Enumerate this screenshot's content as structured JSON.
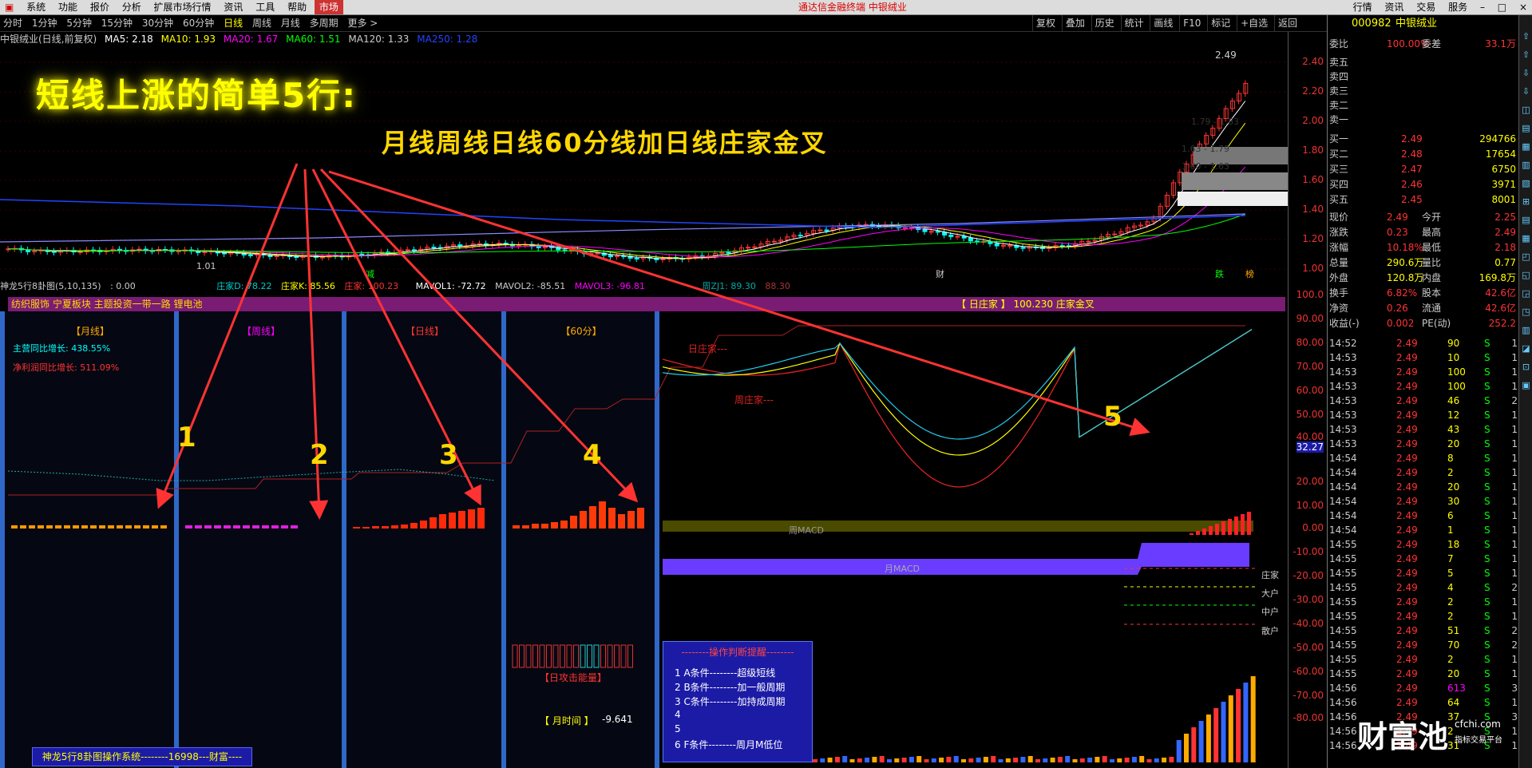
{
  "menu": {
    "items": [
      "系统",
      "功能",
      "报价",
      "分析",
      "扩展市场行情",
      "资讯",
      "工具",
      "帮助"
    ],
    "market": "市场",
    "center_title": "通达信金融终端  中银绒业",
    "right_items": [
      "行情",
      "资讯",
      "交易",
      "服务"
    ]
  },
  "toolbar": {
    "periods": [
      "分时",
      "1分钟",
      "5分钟",
      "15分钟",
      "30分钟",
      "60分钟",
      "日线",
      "周线",
      "月线",
      "多周期",
      "更多 >"
    ],
    "active": "日线",
    "right_items": [
      "复权",
      "叠加",
      "历史",
      "统计",
      "画线",
      "F10",
      "标记",
      "+自选",
      "返回"
    ]
  },
  "info": {
    "title": "中银绒业(日线,前复权)",
    "ma5": "MA5: 2.18",
    "ma10": "MA10: 1.93",
    "ma20": "MA20: 1.67",
    "ma60": "MA60: 1.51",
    "ma120": "MA120: 1.33",
    "ma250": "MA250: 1.28",
    "high_label": "2.49",
    "low_label": "1.01",
    "box1": "1.79 - 1.83",
    "box2": "1.63 - 1.79",
    "box3": "1.60 - 1.63",
    "marks": [
      "减",
      "财",
      "跌",
      "榜"
    ]
  },
  "headline": "短线上涨的简单5行:",
  "subline": "月线周线日线60分线加日线庄家金叉",
  "arrow_numbers": [
    "1",
    "2",
    "3",
    "4",
    "5"
  ],
  "subheader": {
    "name": "神龙5行8卦图(5,10,135)",
    "v0": ": 0.00",
    "d": "庄家D: 78.22",
    "k": "庄家K: 85.56",
    "z": "庄家: 100.23",
    "mavol1": "MAVOL1: -72.72",
    "mavol2": "MAVOL2: -85.51",
    "mavol3": "MAVOL3: -96.81",
    "zj": "周ZJ1: 89.30",
    "zj2": "88.30"
  },
  "purplebar": {
    "left": "纺织服饰 宁夏板块 主题投资一带一路 锂电池",
    "right": "【 日庄家 】 100.230  庄家金叉"
  },
  "panels": {
    "monthly": "【月线】",
    "weekly": "【周线】",
    "daily": "【日线】",
    "h60": "【60分】",
    "growth1": "主营同比增长: 438.55%",
    "growth2": "净利润同比增长: 511.09%",
    "day_zhuang": "日庄家---",
    "week_zhuang": "周庄家---",
    "week_macd": "周MACD",
    "month_macd": "月MACD",
    "legend": [
      "庄家",
      "大户",
      "中户",
      "散户"
    ],
    "attack": "【日攻击能量】",
    "month_time_label": "【 月时间 】",
    "month_time_value": "-9.641"
  },
  "opbox": {
    "title": "--------操作判断提醒--------",
    "lines": [
      "1  A条件--------超级短线",
      "2  B条件--------加一般周期",
      "3  C条件--------加持成周期",
      "4",
      "5",
      "6  F条件--------周月M低位"
    ]
  },
  "sysbar": "神龙5行8卦图操作系统--------16998---财富----",
  "yaxis_main": [
    "2.40",
    "2.20",
    "2.00",
    "1.80",
    "1.60",
    "1.40",
    "1.20",
    "1.00"
  ],
  "yaxis_ind": [
    "100.0",
    "90.00",
    "80.00",
    "70.00",
    "60.00",
    "50.00",
    "40.00",
    "32.27",
    "20.00",
    "10.00",
    "0.00",
    "-10.00",
    "-20.00",
    "-30.00",
    "-40.00",
    "-50.00",
    "-60.00",
    "-70.00",
    "-80.00"
  ],
  "quote": {
    "code": "000982",
    "name": "中银绒业",
    "weibi_label": "委比",
    "weibi": "100.00%",
    "weicha_label": "委差",
    "weicha": "33.1万",
    "sells": [
      "卖五",
      "卖四",
      "卖三",
      "卖二",
      "卖一"
    ],
    "buys": [
      [
        "买一",
        "2.49",
        "294766"
      ],
      [
        "买二",
        "2.48",
        "17654"
      ],
      [
        "买三",
        "2.47",
        "6750"
      ],
      [
        "买四",
        "2.46",
        "3971"
      ],
      [
        "买五",
        "2.45",
        "8001"
      ]
    ],
    "stats": [
      [
        "现价",
        "2.49",
        "今开",
        "2.25"
      ],
      [
        "涨跌",
        "0.23",
        "最高",
        "2.49"
      ],
      [
        "涨幅",
        "10.18%",
        "最低",
        "2.18"
      ],
      [
        "总量",
        "290.6万",
        "量比",
        "0.77"
      ],
      [
        "外盘",
        "120.8万",
        "内盘",
        "169.8万"
      ],
      [
        "换手",
        "6.82%",
        "股本",
        "42.6亿"
      ],
      [
        "净资",
        "0.26",
        "流通",
        "42.6亿"
      ],
      [
        "收益(-)",
        "0.002",
        "PE(动)",
        "252.2"
      ]
    ],
    "ticks": [
      [
        "14:52",
        "2.49",
        "90",
        "S",
        "1"
      ],
      [
        "14:53",
        "2.49",
        "10",
        "S",
        "1"
      ],
      [
        "14:53",
        "2.49",
        "100",
        "S",
        "1"
      ],
      [
        "14:53",
        "2.49",
        "100",
        "S",
        "1"
      ],
      [
        "14:53",
        "2.49",
        "46",
        "S",
        "2"
      ],
      [
        "14:53",
        "2.49",
        "12",
        "S",
        "1"
      ],
      [
        "14:53",
        "2.49",
        "43",
        "S",
        "1"
      ],
      [
        "14:53",
        "2.49",
        "20",
        "S",
        "1"
      ],
      [
        "14:54",
        "2.49",
        "8",
        "S",
        "1"
      ],
      [
        "14:54",
        "2.49",
        "2",
        "S",
        "1"
      ],
      [
        "14:54",
        "2.49",
        "20",
        "S",
        "1"
      ],
      [
        "14:54",
        "2.49",
        "30",
        "S",
        "1"
      ],
      [
        "14:54",
        "2.49",
        "6",
        "S",
        "1"
      ],
      [
        "14:54",
        "2.49",
        "1",
        "S",
        "1"
      ],
      [
        "14:55",
        "2.49",
        "18",
        "S",
        "1"
      ],
      [
        "14:55",
        "2.49",
        "7",
        "S",
        "1"
      ],
      [
        "14:55",
        "2.49",
        "5",
        "S",
        "1"
      ],
      [
        "14:55",
        "2.49",
        "4",
        "S",
        "2"
      ],
      [
        "14:55",
        "2.49",
        "2",
        "S",
        "1"
      ],
      [
        "14:55",
        "2.49",
        "2",
        "S",
        "1"
      ],
      [
        "14:55",
        "2.49",
        "51",
        "S",
        "2"
      ],
      [
        "14:55",
        "2.49",
        "70",
        "S",
        "2"
      ],
      [
        "14:55",
        "2.49",
        "2",
        "S",
        "1"
      ],
      [
        "14:55",
        "2.49",
        "20",
        "S",
        "1"
      ],
      [
        "14:56",
        "2.49",
        "613",
        "S",
        "3"
      ],
      [
        "14:56",
        "2.49",
        "64",
        "S",
        "1"
      ],
      [
        "14:56",
        "2.49",
        "37",
        "S",
        "3"
      ],
      [
        "14:56",
        "2.49",
        "2",
        "S",
        "1"
      ],
      [
        "14:56",
        "2.49",
        "31",
        "S",
        "1"
      ]
    ]
  },
  "watermark": {
    "main": "财富池",
    "site": "cfchi.com",
    "tag": "指标交易平台"
  },
  "colors": {
    "up": "#ff3333",
    "down": "#00ffff",
    "purple": "#7a1c74",
    "blue": "#2f68c8"
  }
}
